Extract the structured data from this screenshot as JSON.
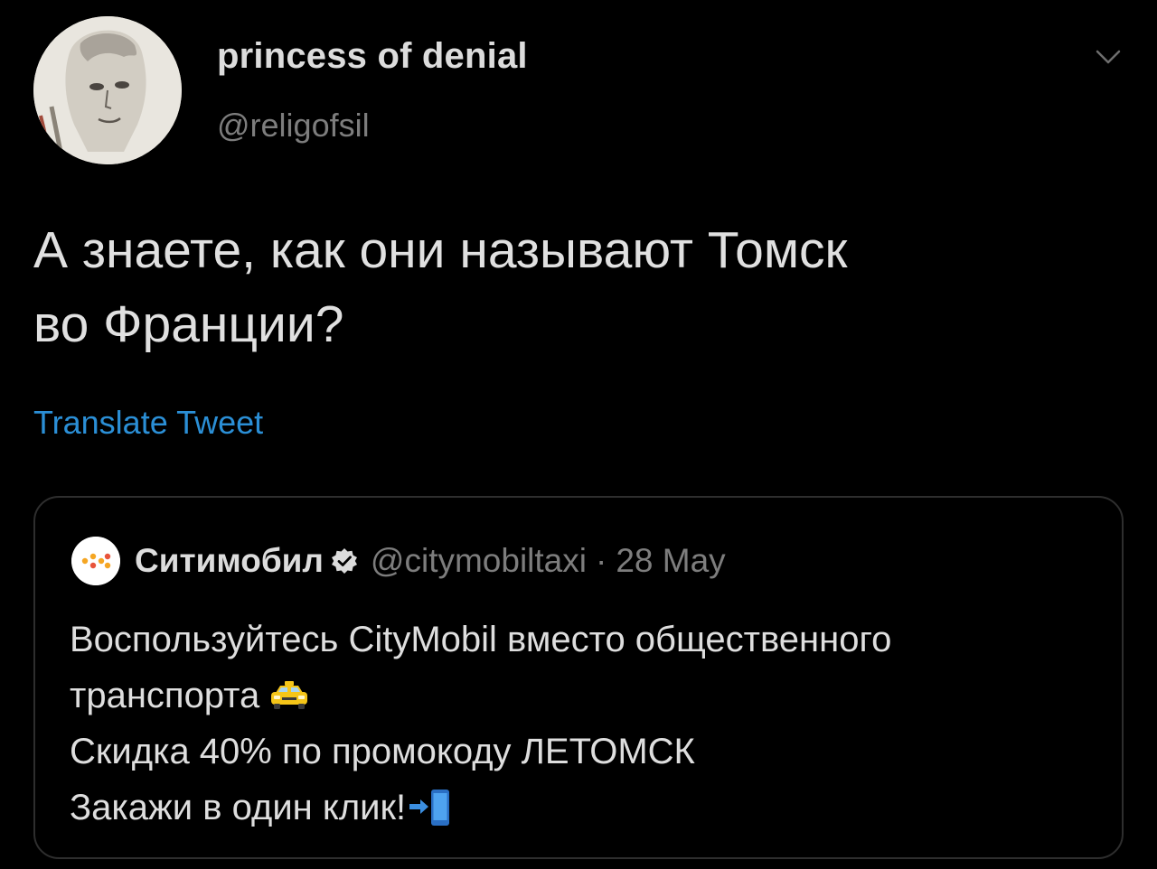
{
  "tweet": {
    "display_name": "princess of denial",
    "handle": "@religofsil",
    "text_lines": [
      "А знаете, как они называют Томск",
      "во Франции?"
    ],
    "translate_label": "Translate Tweet",
    "avatar_icon": "portrait-drawing-avatar",
    "more_icon": "chevron-down-icon"
  },
  "quoted_tweet": {
    "display_name": "Ситимобил",
    "verified_icon": "verified-badge-icon",
    "handle": "@citymobiltaxi",
    "separator": "·",
    "date": "28 May",
    "avatar_icon": "citymobil-logo",
    "text_lines": [
      "Воспользуйтесь CityMobil вместо общественного",
      "транспорта",
      "Скидка 40% по промокоду ЛЕТОМСК",
      "Закажи в один клик!"
    ],
    "emojis": [
      "taxi-emoji",
      "mobile-arrow-emoji"
    ]
  },
  "colors": {
    "background": "#000000",
    "link": "#2b8fd6",
    "secondary_text": "#7d7d7d",
    "border": "#2e2e2e",
    "brand_orange": "#f5a623"
  }
}
